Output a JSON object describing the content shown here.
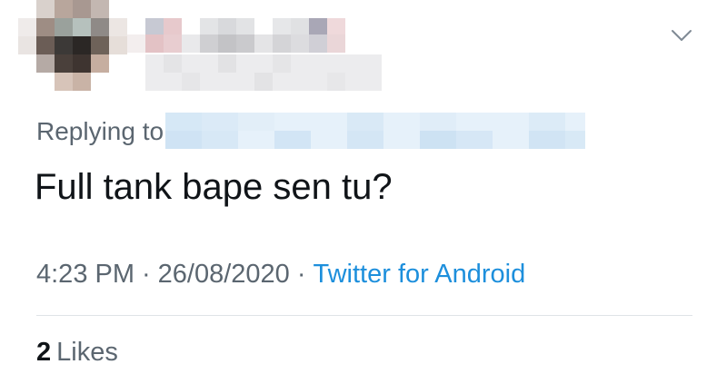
{
  "tweet": {
    "reply_prefix": "Replying to",
    "text": "Full tank bape sen tu?",
    "time": "4:23 PM",
    "date": "26/08/2020",
    "separator": "·",
    "source": "Twitter for Android",
    "likes_count": "2",
    "likes_label": "Likes"
  },
  "icons": {
    "menu": "chevron-down-icon"
  },
  "colors": {
    "link": "#1d8fdc",
    "secondary_text": "#5b6670",
    "primary_text": "#101418",
    "divider": "#dfe3e7"
  }
}
